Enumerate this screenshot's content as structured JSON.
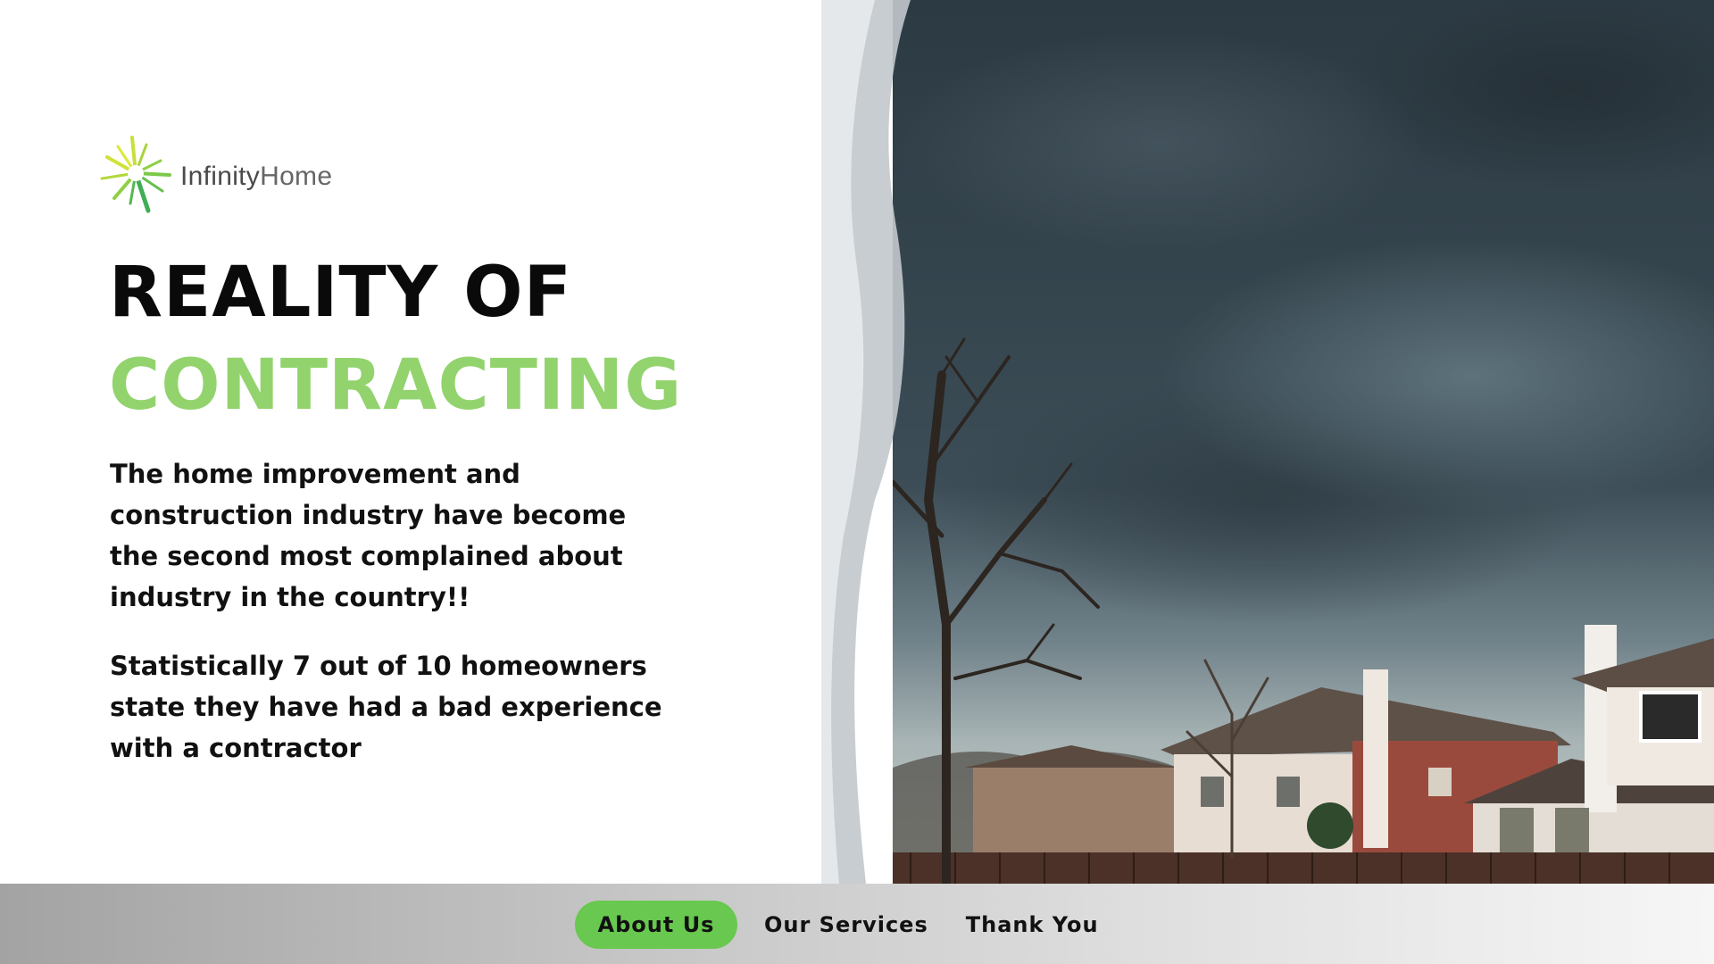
{
  "brand": {
    "name_strong": "Infinity",
    "name_light": "Home",
    "logo_icon": "starburst-icon",
    "colors": {
      "accent_green": "#92d36e",
      "nav_green": "#68c84f"
    }
  },
  "headline": {
    "line1": "REALITY OF",
    "line2": "CONTRACTING"
  },
  "body": {
    "paragraph1": "The home improvement and construction industry have become the second most complained about industry in the country!!",
    "paragraph2": "Statistically 7 out of 10 homeowners state they have had a bad experience with a contractor"
  },
  "nav": {
    "items": [
      {
        "label": "About Us",
        "active": true
      },
      {
        "label": "Our Services",
        "active": false
      },
      {
        "label": "Thank You",
        "active": false
      }
    ]
  }
}
